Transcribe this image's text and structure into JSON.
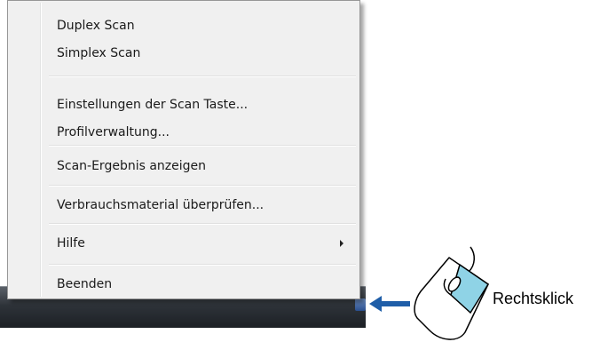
{
  "context_menu": {
    "items": [
      {
        "label": "Duplex Scan"
      },
      {
        "label": "Simplex Scan"
      },
      {
        "label": "Einstellungen der Scan Taste..."
      },
      {
        "label": "Profilverwaltung..."
      },
      {
        "label": "Scan-Ergebnis anzeigen"
      },
      {
        "label": "Verbrauchsmaterial überprüfen..."
      },
      {
        "label": "Hilfe",
        "has_submenu": true
      },
      {
        "label": "Beenden"
      }
    ]
  },
  "callout": {
    "label": "Rechtsklick",
    "arrow_color": "#1f5ea8",
    "mouse_button_color": "#8fd3e6"
  },
  "icons": [
    "tray-scanner-icon",
    "left-arrow-icon",
    "mouse-icon",
    "submenu-arrow-icon"
  ]
}
